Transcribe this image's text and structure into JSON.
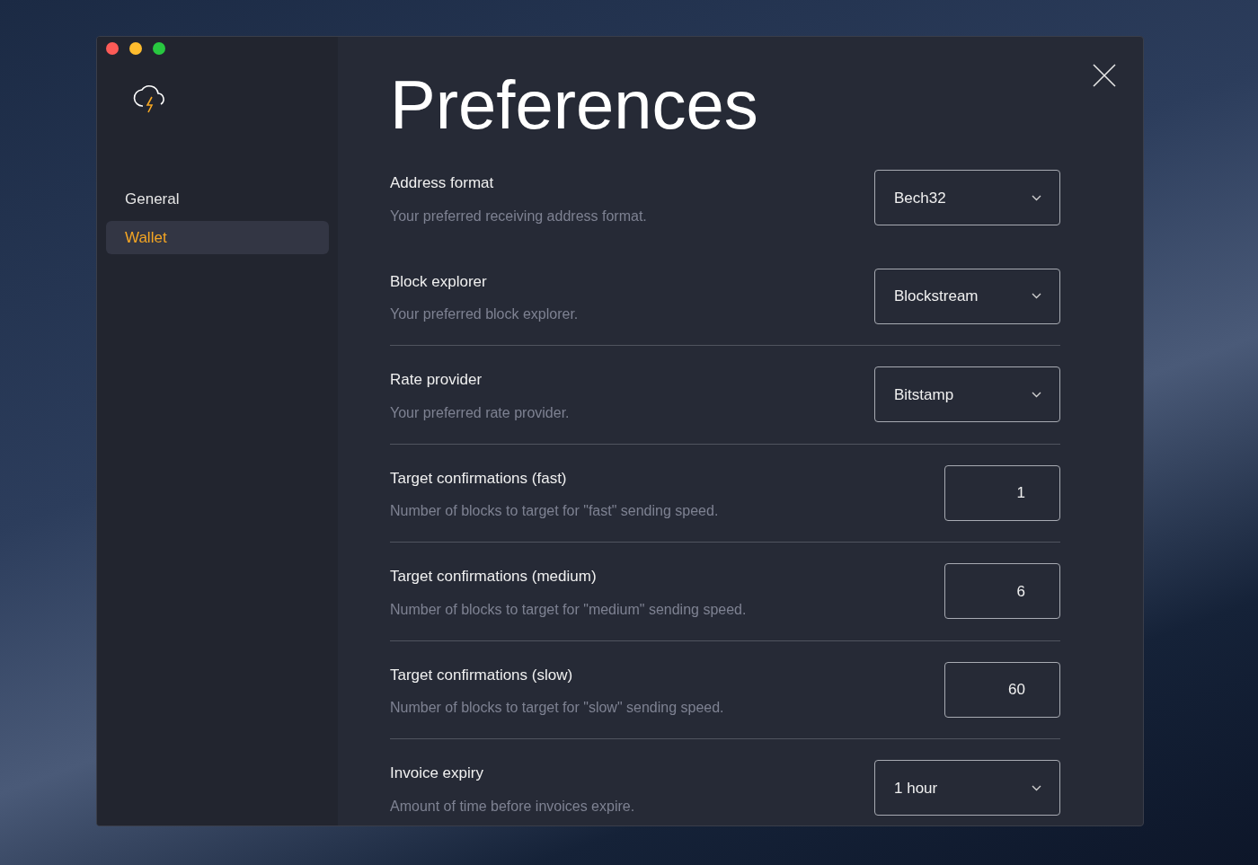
{
  "window": {
    "title": "Preferences"
  },
  "sidebar": {
    "items": [
      {
        "label": "General",
        "selected": false
      },
      {
        "label": "Wallet",
        "selected": true
      }
    ]
  },
  "settings": [
    {
      "kind": "select",
      "label": "Address format",
      "description": "Your preferred receiving address format.",
      "value": "Bech32",
      "divider": false
    },
    {
      "kind": "select",
      "label": "Block explorer",
      "description": "Your preferred block explorer.",
      "value": "Blockstream",
      "divider": true
    },
    {
      "kind": "select",
      "label": "Rate provider",
      "description": "Your preferred rate provider.",
      "value": "Bitstamp",
      "divider": true
    },
    {
      "kind": "number",
      "label": "Target confirmations (fast)",
      "description": "Number of blocks to target for \"fast\" sending speed.",
      "value": "1",
      "divider": true
    },
    {
      "kind": "number",
      "label": "Target confirmations (medium)",
      "description": "Number of blocks to target for \"medium\" sending speed.",
      "value": "6",
      "divider": true
    },
    {
      "kind": "number",
      "label": "Target confirmations (slow)",
      "description": "Number of blocks to target for \"slow\" sending speed.",
      "value": "60",
      "divider": true
    },
    {
      "kind": "select",
      "label": "Invoice expiry",
      "description": "Amount of time before invoices expire.",
      "value": "1 hour",
      "divider": false
    }
  ]
}
